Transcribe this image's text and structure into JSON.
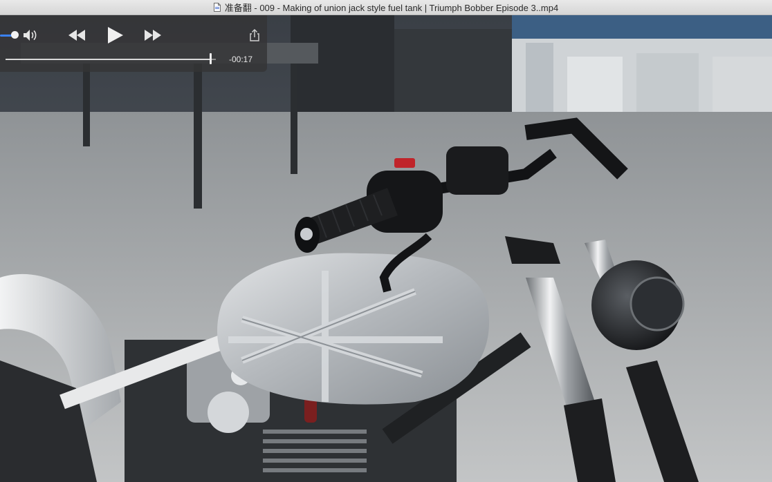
{
  "window": {
    "title": "准备翻 - 009 - Making of union jack style fuel tank | Triumph Bobber Episode 3..mp4"
  },
  "player": {
    "volume_level": 0.25,
    "progress": 0.975,
    "time_remaining": "-00:17"
  },
  "icons": {
    "title_icon": "document-icon",
    "volume": "speaker-volume-icon",
    "rewind": "rewind-icon",
    "play": "play-icon",
    "fast_forward": "fast-forward-icon",
    "share": "share-icon"
  },
  "colors": {
    "accent": "#3b82f6",
    "tank": "#b8bcc0"
  }
}
